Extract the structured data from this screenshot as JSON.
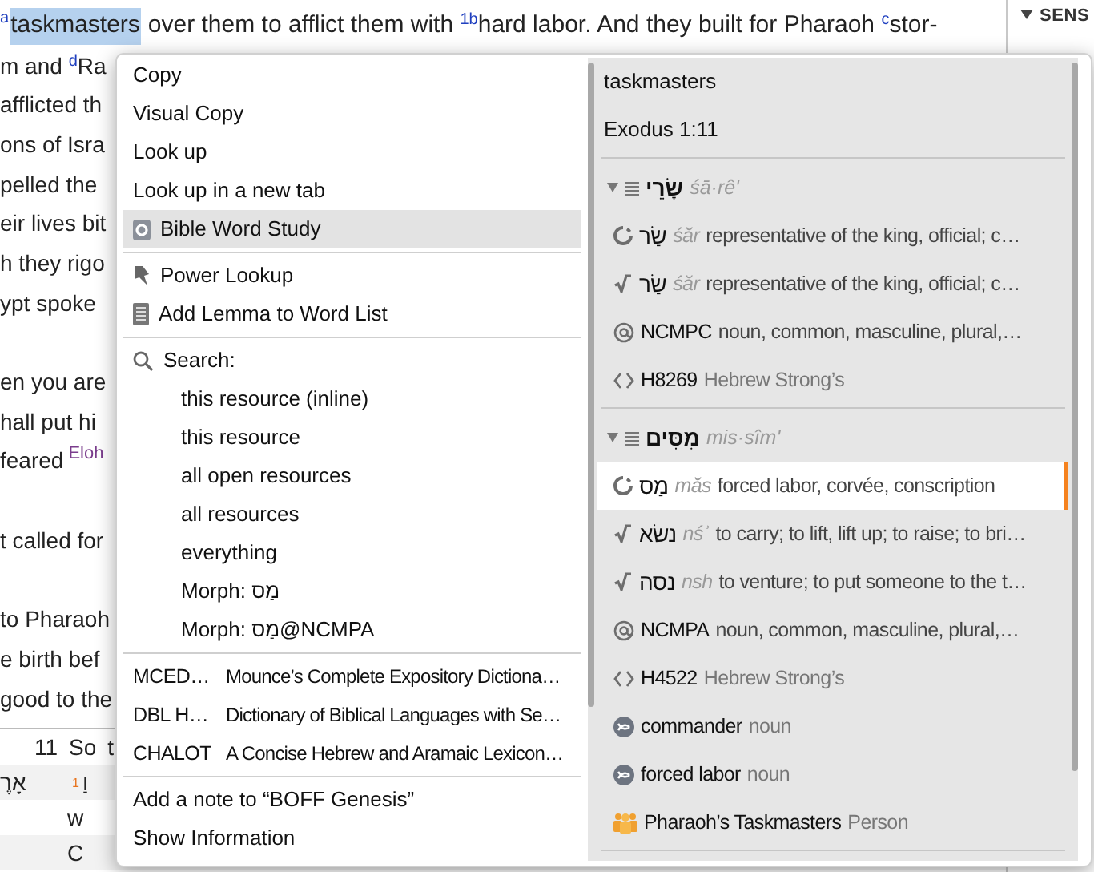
{
  "document": {
    "first_line": {
      "marker": "a",
      "selected_word": "taskmasters",
      "selected": true,
      "text": "over them to afflict them with $^{1b}$hard labor. And they built for Pharaoh $^{c}$stor-"
    },
    "lines": [
      {
        "kind": "text",
        "text": "m and $^{d}$Ra"
      },
      {
        "kind": "text",
        "text": "afflicted th"
      },
      {
        "kind": "text",
        "text": "ons of Isra"
      },
      {
        "kind": "text",
        "text": "pelled the"
      },
      {
        "kind": "text",
        "text": "eir lives bit"
      },
      {
        "kind": "text",
        "text": "h they rigo"
      },
      {
        "kind": "text",
        "text": "ypt spoke"
      },
      {
        "kind": "blank"
      },
      {
        "kind": "text",
        "text": "en you are"
      },
      {
        "kind": "text",
        "text": "hall put hi"
      },
      {
        "kind": "noted",
        "text": "feared",
        "note": "Eloh"
      },
      {
        "kind": "blank"
      },
      {
        "kind": "text",
        "text": "t called for"
      },
      {
        "kind": "blank"
      },
      {
        "kind": "text",
        "text": "to Pharaoh"
      },
      {
        "kind": "text",
        "text": "e birth bef"
      },
      {
        "kind": "text",
        "text": "good to the"
      }
    ],
    "interlinear": {
      "verse_number": "11",
      "english": [
        "So",
        "t"
      ],
      "hebrew_previous": "אָרֶ",
      "word_number": "1",
      "hebrew": "וַ",
      "transliteration": "w",
      "morph": "C"
    }
  },
  "side_panel": {
    "heading": "SENS",
    "expanded": true
  },
  "context_menu": {
    "sections": [
      {
        "items": [
          {
            "kind": "command",
            "label": "Copy",
            "selected": false
          },
          {
            "kind": "command",
            "label": "Visual Copy",
            "selected": false
          },
          {
            "kind": "command",
            "label": "Look up",
            "selected": false
          },
          {
            "kind": "command",
            "label": "Look up in a new tab",
            "selected": false
          },
          {
            "kind": "word_study",
            "label": "Bible Word Study",
            "selected": true
          }
        ]
      },
      {
        "items": [
          {
            "kind": "power_lookup",
            "label": "Power Lookup",
            "selected": false
          },
          {
            "kind": "word_list",
            "label": "Add Lemma to Word List",
            "selected": false
          }
        ]
      },
      {
        "items": [
          {
            "kind": "search_header",
            "label": "Search:",
            "selected": false
          },
          {
            "kind": "search_scope",
            "label": "this resource (inline)",
            "selected": false
          },
          {
            "kind": "search_scope",
            "label": "this resource",
            "selected": false
          },
          {
            "kind": "search_scope",
            "label": "all open resources",
            "selected": false
          },
          {
            "kind": "search_scope",
            "label": "all resources",
            "selected": false
          },
          {
            "kind": "search_scope",
            "label": "everything",
            "selected": false
          },
          {
            "kind": "search_scope",
            "label": "Morph: מַס",
            "selected": false
          },
          {
            "kind": "search_scope",
            "label": "Morph: מַס@NCMPA",
            "selected": false
          }
        ]
      },
      {
        "items": [
          {
            "kind": "resource",
            "abbreviation": "MCED…",
            "label": "Mounce’s Complete Expository Dictiona…",
            "selected": false
          },
          {
            "kind": "resource",
            "abbreviation": "DBL H…",
            "label": "Dictionary of Biblical Languages with Se…",
            "selected": false
          },
          {
            "kind": "resource",
            "abbreviation": "CHALOT",
            "label": "A Concise Hebrew and Aramaic Lexicon…",
            "selected": false
          }
        ]
      },
      {
        "items": [
          {
            "kind": "command",
            "label": "Add a note to “BOFF Genesis”",
            "selected": false
          },
          {
            "kind": "command",
            "label": "Show Information",
            "selected": false
          }
        ]
      }
    ]
  },
  "word_panel": {
    "title": "taskmasters",
    "reference": "Exodus 1:11",
    "groups": [
      {
        "expanded": true,
        "hebrew": "שָׂרֵי",
        "transliteration": "śā·rê'",
        "rows": [
          {
            "kind": "lemma",
            "head": "שַׂר",
            "transliteration": "śăr",
            "gloss": "representative of the king, official; c…",
            "selected": false
          },
          {
            "kind": "root",
            "head": "שַׂר",
            "transliteration": "śăr",
            "gloss": "representative of the king, official; c…",
            "selected": false
          },
          {
            "kind": "morph",
            "head": "NCMPC",
            "gloss": "noun, common, masculine, plural,…",
            "selected": false
          },
          {
            "kind": "strongs",
            "head": "H8269",
            "gloss": "Hebrew Strong’s",
            "selected": false
          }
        ]
      },
      {
        "expanded": true,
        "hebrew": "מִסִּים",
        "transliteration": "mis·sîm'",
        "rows": [
          {
            "kind": "lemma",
            "head": "מַס",
            "transliteration": "măs",
            "gloss": "forced labor, corvée, conscription",
            "selected": true
          },
          {
            "kind": "root",
            "head": "נשׂא",
            "transliteration": "nśʾ",
            "gloss": "to carry; to lift, lift up; to raise; to bri…",
            "selected": false
          },
          {
            "kind": "root",
            "head": "נסה",
            "transliteration": "nsh",
            "gloss": "to venture; to put someone to the t…",
            "selected": false
          },
          {
            "kind": "morph",
            "head": "NCMPA",
            "gloss": "noun, common, masculine, plural,…",
            "selected": false
          },
          {
            "kind": "strongs",
            "head": "H4522",
            "gloss": "Hebrew Strong’s",
            "selected": false
          },
          {
            "kind": "sense",
            "head": "commander",
            "gloss": "noun",
            "selected": false
          },
          {
            "kind": "sense",
            "head": "forced labor",
            "gloss": "noun",
            "selected": false
          },
          {
            "kind": "person",
            "head": "Pharaoh’s Taskmasters",
            "gloss": "Person",
            "selected": false
          }
        ]
      }
    ]
  }
}
